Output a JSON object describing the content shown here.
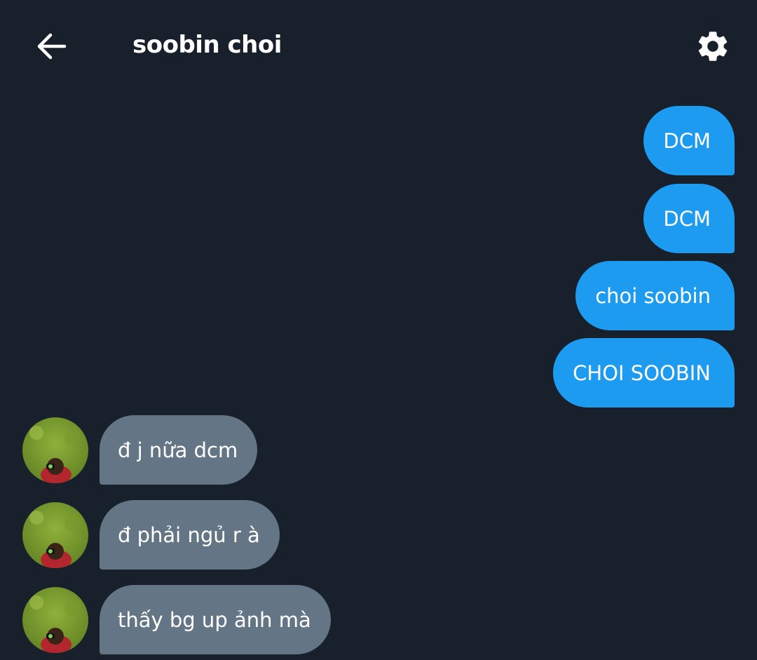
{
  "header": {
    "back_icon": "arrow-left-icon",
    "title": "soobin choi",
    "settings_icon": "gear-icon"
  },
  "colors": {
    "background": "#17202b",
    "sent_bubble": "#1d9bf0",
    "received_bubble": "#647585",
    "text": "#ffffff"
  },
  "messages": {
    "sent": [
      {
        "text": "DCM"
      },
      {
        "text": "DCM"
      },
      {
        "text": "choi soobin"
      },
      {
        "text": "CHOI SOOBIN"
      }
    ],
    "received": [
      {
        "text": "đ j nữa dcm",
        "avatar_icon": "contact-avatar"
      },
      {
        "text": "đ phải ngủ r à",
        "avatar_icon": "contact-avatar"
      },
      {
        "text": "thấy bg up ảnh mà",
        "avatar_icon": "contact-avatar"
      }
    ]
  }
}
